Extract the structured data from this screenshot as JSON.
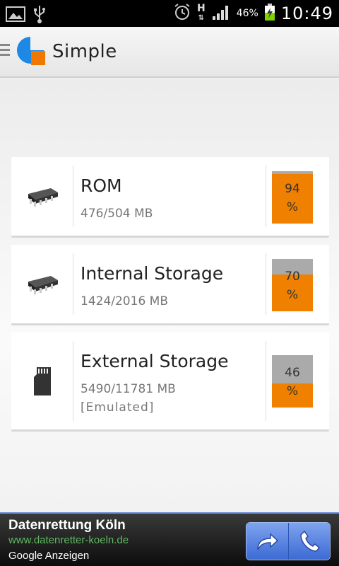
{
  "status_bar": {
    "icons_left": [
      "image-icon",
      "usb-icon"
    ],
    "icons_right": [
      "alarm-icon",
      "h-data-icon",
      "signal-icon",
      "battery-icon"
    ],
    "network_type": "H",
    "battery": "46%",
    "time": "10:49"
  },
  "app_bar": {
    "title": "Simple",
    "logo_colors": {
      "blue": "#1e88e5",
      "orange": "#f07800"
    }
  },
  "storage": [
    {
      "name": "ROM",
      "usage": "476/504 MB",
      "note": "",
      "percent": 94,
      "percent_label": "94",
      "unit": "%",
      "icon": "chip-icon"
    },
    {
      "name": "Internal Storage",
      "usage": "1424/2016 MB",
      "note": "",
      "percent": 70,
      "percent_label": "70",
      "unit": "%",
      "icon": "chip-icon"
    },
    {
      "name": "External Storage",
      "usage": "5490/11781 MB",
      "note": "[Emulated]",
      "percent": 46,
      "percent_label": "46",
      "unit": "%",
      "icon": "sd-card-icon"
    }
  ],
  "colors": {
    "gauge_fill": "#f08000",
    "gauge_empty": "#aaaaaa"
  },
  "ad": {
    "title": "Datenrettung Köln",
    "url": "www.datenretter-koeln.de",
    "source": "Google Anzeigen",
    "buttons": [
      "share-arrow-icon",
      "phone-icon"
    ]
  }
}
